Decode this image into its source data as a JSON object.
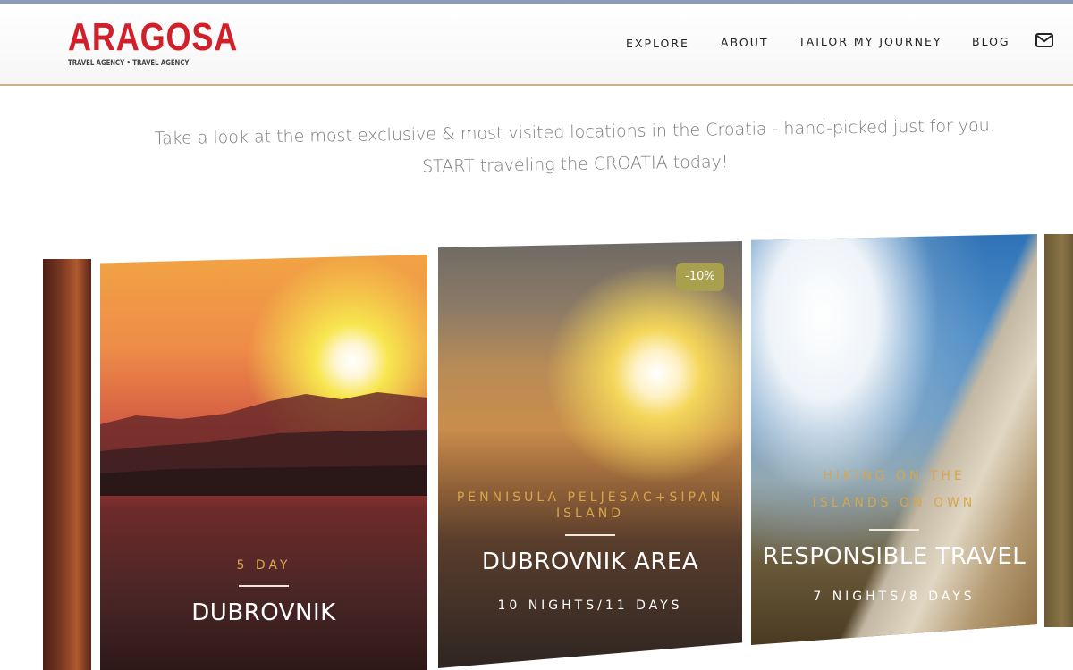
{
  "brand": {
    "name": "ARAGOSA",
    "tagline": "TRAVEL AGENCY • TRAVEL AGENCY",
    "accent": "#d0202a"
  },
  "nav": {
    "items": [
      "EXPLORE",
      "ABOUT",
      "TAILOR MY JOURNEY",
      "BLOG"
    ],
    "mail_icon": "envelope-icon"
  },
  "intro": {
    "line1": "Take a look at the most exclusive & most visited locations in the Croatia - hand-picked just for you.",
    "line2": "START traveling the CROATIA today!"
  },
  "tours": [
    {
      "subtitle": "5 DAY",
      "title": "DUBROVNIK",
      "duration": ""
    },
    {
      "subtitle": "PENNISULA PELJESAC+SIPAN ISLAND",
      "title": "DUBROVNIK AREA",
      "duration": "10 NIGHTS/11 DAYS",
      "badge": "-10%"
    },
    {
      "subtitle": "HIKING ON THE ISLANDS ON OWN",
      "title": "RESPONSIBLE TRAVEL",
      "duration": "7 NIGHTS/8 DAYS"
    }
  ],
  "colors": {
    "nav_text": "#222222",
    "header_border": "#c9b489",
    "subtitle_gold": "#d8a64a",
    "badge_bg": "#a8a04f"
  }
}
